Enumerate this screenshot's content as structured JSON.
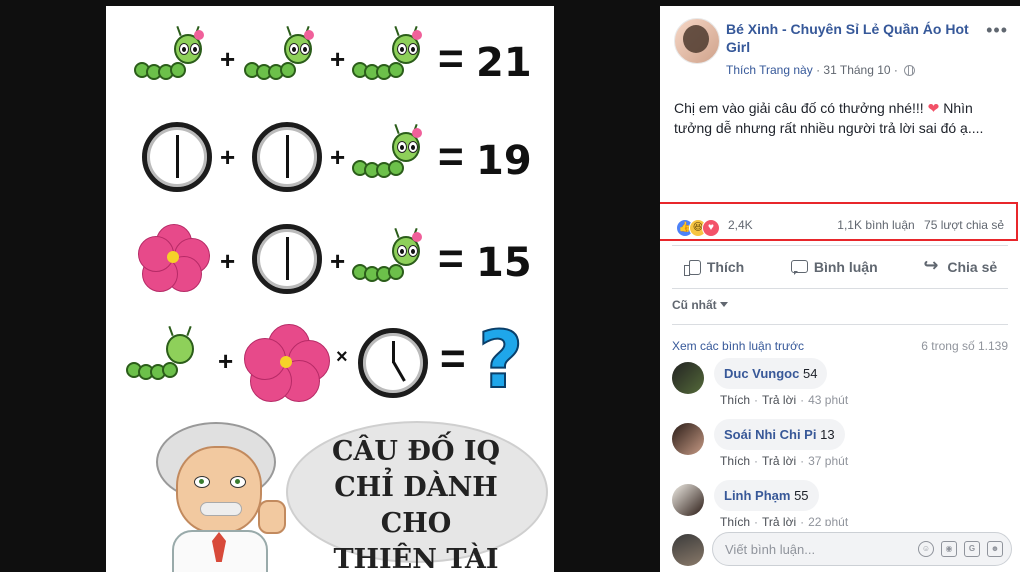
{
  "puzzle": {
    "rows": [
      {
        "op1": "+",
        "op2": "+",
        "eq": "=",
        "result": "21"
      },
      {
        "op1": "+",
        "op2": "+",
        "eq": "=",
        "result": "19"
      },
      {
        "op1": "+",
        "op2": "+",
        "eq": "=",
        "result": "15"
      },
      {
        "op1": "+",
        "op2": "×",
        "eq": "=",
        "result": "?"
      }
    ],
    "caption_lines": [
      "CÂU ĐỐ IQ",
      "CHỈ DÀNH CHO",
      "THIÊN TÀI"
    ]
  },
  "post": {
    "page_name": "Bé Xinh - Chuyên Sỉ Lẻ Quần Áo Hot Girl",
    "more": "•••",
    "like_page": "Thích Trang này",
    "dot": "·",
    "date": "31 Tháng 10",
    "dot2": "·",
    "text_before_heart": "Chị em vào giải câu đố có thưởng nhé!!!",
    "text_after_heart": "Nhìn tưởng dễ nhưng rất nhiều người trả lời sai đó ạ...."
  },
  "reactions": {
    "count": "2,4K",
    "comments": "1,1K bình luận",
    "shares": "75 lượt chia sẻ"
  },
  "actions": {
    "like": "Thích",
    "comment": "Bình luận",
    "share": "Chia sẻ"
  },
  "comments_section": {
    "sort": "Cũ nhất",
    "view_previous": "Xem các bình luận trước",
    "count": "6 trong số 1.139",
    "items": [
      {
        "name": "Duc Vungoc",
        "text": "54",
        "like": "Thích",
        "reply": "Trả lời",
        "time": "43 phút"
      },
      {
        "name": "Soái Nhi Chi Pi",
        "text": "13",
        "like": "Thích",
        "reply": "Trả lời",
        "time": "37 phút"
      },
      {
        "name": "Linh Phạm",
        "text": "55",
        "like": "Thích",
        "reply": "Trả lời",
        "time": "22 phút"
      }
    ],
    "input_placeholder": "Viết bình luận..."
  },
  "colors": {
    "highlight": "#e8262b",
    "link": "#365899",
    "background": "#0f0f0f"
  },
  "icons": [
    "more-icon",
    "globe-icon",
    "like-reaction-icon",
    "haha-reaction-icon",
    "love-reaction-icon",
    "thumb-icon",
    "comment-icon",
    "share-icon",
    "caret-down-icon",
    "emoji-icon",
    "camera-icon",
    "gif-icon",
    "sticker-icon"
  ]
}
